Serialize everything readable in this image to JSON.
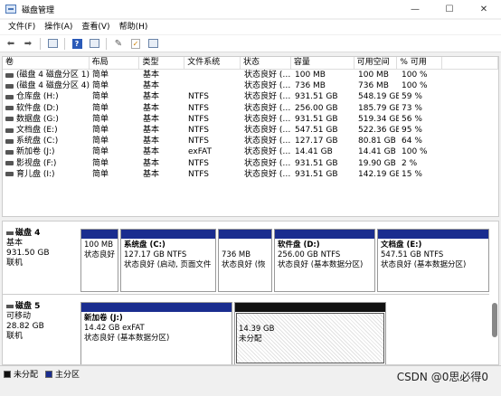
{
  "window": {
    "title": "磁盘管理",
    "controls": [
      "minimize",
      "maximize",
      "close"
    ]
  },
  "menu": [
    "文件(F)",
    "操作(A)",
    "查看(V)",
    "帮助(H)"
  ],
  "toolbar": {
    "icons": [
      "back-icon",
      "forward-icon",
      "volume-list-icon",
      "help-icon",
      "list-view-icon",
      "connect-icon",
      "properties-icon",
      "console-icon"
    ]
  },
  "volume_table": {
    "columns": [
      "卷",
      "布局",
      "类型",
      "文件系统",
      "状态",
      "容量",
      "可用空间",
      "% 可用"
    ],
    "rows": [
      [
        "(磁盘 4 磁盘分区 1)",
        "简单",
        "基本",
        "",
        "状态良好 (…",
        "100 MB",
        "100 MB",
        "100 %"
      ],
      [
        "(磁盘 4 磁盘分区 4)",
        "简单",
        "基本",
        "",
        "状态良好 (…",
        "736 MB",
        "736 MB",
        "100 %"
      ],
      [
        "仓库盘 (H:)",
        "简单",
        "基本",
        "NTFS",
        "状态良好 (…",
        "931.51 GB",
        "548.19 GB",
        "59 %"
      ],
      [
        "软件盘 (D:)",
        "简单",
        "基本",
        "NTFS",
        "状态良好 (…",
        "256.00 GB",
        "185.79 GB",
        "73 %"
      ],
      [
        "数据盘 (G:)",
        "简单",
        "基本",
        "NTFS",
        "状态良好 (…",
        "931.51 GB",
        "519.34 GB",
        "56 %"
      ],
      [
        "文档盘 (E:)",
        "简单",
        "基本",
        "NTFS",
        "状态良好 (…",
        "547.51 GB",
        "522.36 GB",
        "95 %"
      ],
      [
        "系统盘 (C:)",
        "简单",
        "基本",
        "NTFS",
        "状态良好 (…",
        "127.17 GB",
        "80.81 GB",
        "64 %"
      ],
      [
        "新加卷 (J:)",
        "简单",
        "基本",
        "exFAT",
        "状态良好 (…",
        "14.41 GB",
        "14.41 GB",
        "100 %"
      ],
      [
        "影视盘 (F:)",
        "简单",
        "基本",
        "NTFS",
        "状态良好 (…",
        "931.51 GB",
        "19.90 GB",
        "2 %"
      ],
      [
        "育儿盘 (I:)",
        "简单",
        "基本",
        "NTFS",
        "状态良好 (…",
        "931.51 GB",
        "142.19 GB",
        "15 %"
      ]
    ]
  },
  "disks": [
    {
      "name": "磁盘 4",
      "type": "基本",
      "size": "931.50 GB",
      "status": "联机",
      "partitions": [
        {
          "name": "",
          "line1": "100 MB",
          "line2": "状态良好"
        },
        {
          "name": "系统盘 (C:)",
          "line1": "127.17 GB NTFS",
          "line2": "状态良好 (启动, 页面文件"
        },
        {
          "name": "",
          "line1": "736 MB",
          "line2": "状态良好 (恢"
        },
        {
          "name": "软件盘 (D:)",
          "line1": "256.00 GB NTFS",
          "line2": "状态良好 (基本数据分区)"
        },
        {
          "name": "文档盘 (E:)",
          "line1": "547.51 GB NTFS",
          "line2": "状态良好 (基本数据分区)"
        }
      ]
    },
    {
      "name": "磁盘 5",
      "type": "可移动",
      "size": "28.82 GB",
      "status": "联机",
      "partitions": [
        {
          "name": "新加卷 (J:)",
          "line1": "14.42 GB exFAT",
          "line2": "状态良好 (基本数据分区)"
        },
        {
          "name": "",
          "line1": "14.39 GB",
          "line2": "未分配"
        }
      ]
    }
  ],
  "legend": [
    {
      "label": "未分配",
      "color": "#111111"
    },
    {
      "label": "主分区",
      "color": "#1a2d8f"
    }
  ],
  "watermark": "CSDN @0思必得0"
}
